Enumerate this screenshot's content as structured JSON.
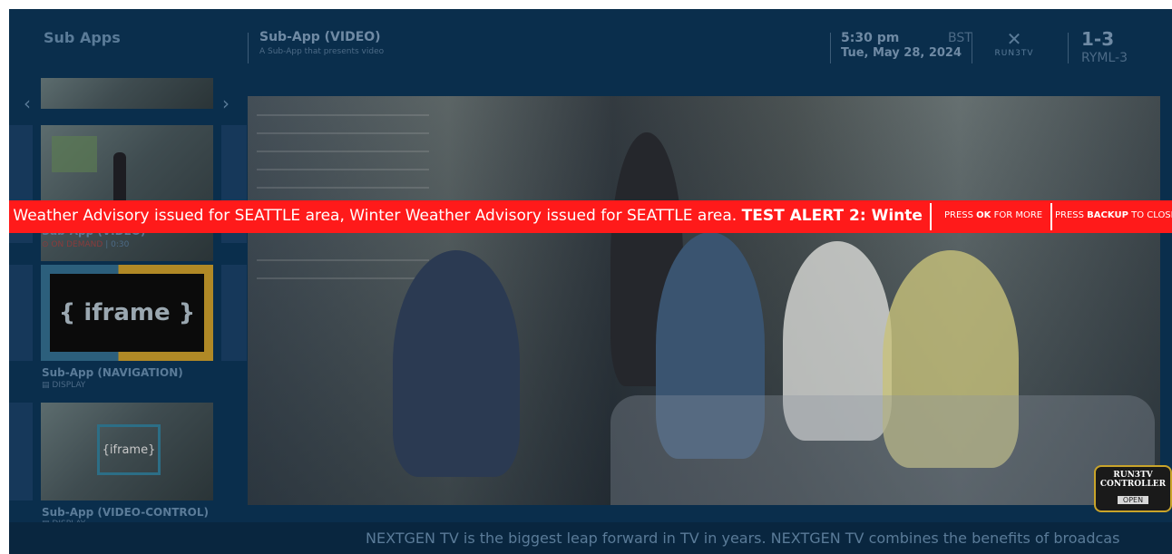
{
  "header": {
    "section_title": "Sub Apps",
    "app_title": "Sub-App (VIDEO)",
    "app_subtitle": "A Sub-App that presents video",
    "time": "5:30 pm",
    "timezone": "BST",
    "date": "Tue, May 28, 2024",
    "logo_text": "RUN3TV",
    "channel_number": "1-3",
    "channel_name": "RYML-3"
  },
  "sidebar": {
    "prev_arrow": "‹",
    "next_arrow": "›",
    "items": [
      {
        "title": "Sub-App (VIDEO)",
        "meta_type": "ON DEMAND",
        "meta_sep": "|",
        "meta_duration": "0:30"
      },
      {
        "title": "Sub-App (NAVIGATION)",
        "thumb_text": "{ iframe }",
        "meta_type": "DISPLAY"
      },
      {
        "title": "Sub-App (VIDEO-CONTROL)",
        "thumb_text": "{iframe}",
        "meta_type": "DISPLAY"
      }
    ]
  },
  "alert": {
    "text": "r Weather Advisory issued for SEATTLE area, Winter Weather Advisory issued for SEATTLE area. ",
    "bold_text": "TEST ALERT 2: Winte",
    "ok_prefix": "PRESS ",
    "ok_key": "OK",
    "ok_suffix": " FOR MORE",
    "backup_prefix": "PRESS ",
    "backup_key": "BACKUP",
    "backup_suffix": " TO CLOSE",
    "color": "#ff1a1a"
  },
  "controller": {
    "line1": "RUN3TV",
    "line2": "CONTROLLER",
    "button": "OPEN"
  },
  "footer": {
    "ticker": "NEXTGEN TV is the biggest leap forward in TV in years. NEXTGEN TV combines the benefits of broadcas"
  },
  "colors": {
    "background": "#0a2e4c",
    "accent": "#c9a42a"
  }
}
